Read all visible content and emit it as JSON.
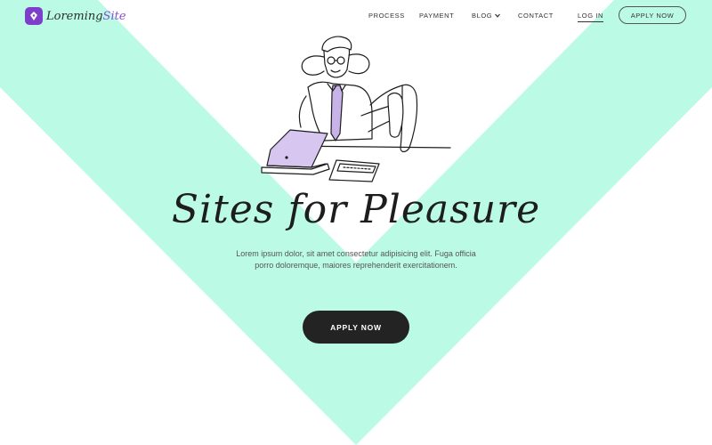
{
  "colors": {
    "accent_bg": "#bbfbe6",
    "brand": "#7d3fc9",
    "cta_bg": "#232323"
  },
  "logo": {
    "name_main": "Loreming",
    "name_accent": "Site",
    "icon": "pen-nib-icon"
  },
  "nav": {
    "process": "PROCESS",
    "payment": "PAYMENT",
    "blog": "BLOG",
    "contact": "CONTACT",
    "login": "LOG IN",
    "apply": "APPLY NOW"
  },
  "hero": {
    "headline": "Sites for Pleasure",
    "subtext": "Lorem ipsum dolor, sit amet consectetur adipisicing elit. Fuga officia porro doloremque, maiores reprehenderit exercitationem.",
    "cta": "APPLY NOW"
  }
}
